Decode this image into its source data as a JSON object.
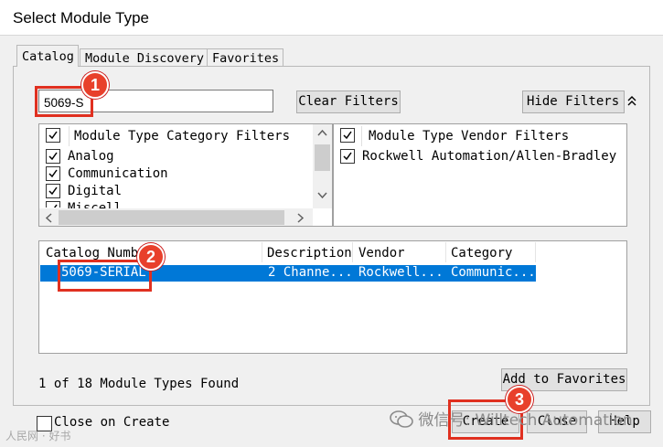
{
  "window": {
    "title": "Select Module Type"
  },
  "tabs": [
    {
      "label": "Catalog",
      "active": true
    },
    {
      "label": "Module Discovery",
      "active": false
    },
    {
      "label": "Favorites",
      "active": false
    }
  ],
  "search": {
    "value": "5069-S"
  },
  "buttons": {
    "clear_filters": "Clear Filters",
    "hide_filters": "Hide Filters",
    "hide_filters_icon": "double-chevron-up-icon",
    "add_to_favorites": "Add to Favorites",
    "create": "Create",
    "close": "Close",
    "help": "Help"
  },
  "category_filters": {
    "header": "Module Type Category Filters",
    "items": [
      {
        "label": "Analog",
        "checked": true
      },
      {
        "label": "Communication",
        "checked": true
      },
      {
        "label": "Digital",
        "checked": true
      },
      {
        "label": "Miscell",
        "checked": true
      }
    ]
  },
  "vendor_filters": {
    "header": "Module Type Vendor Filters",
    "items": [
      {
        "label": "Rockwell Automation/Allen-Bradley",
        "checked": true
      }
    ]
  },
  "results": {
    "columns": [
      "Catalog Numb",
      "Description",
      "Vendor",
      "Category"
    ],
    "rows": [
      {
        "catalog": "5069-SERIAL",
        "description": "2 Channe...",
        "vendor": "Rockwell...",
        "category": "Communic...",
        "selected": true
      }
    ]
  },
  "status": {
    "found_text": "1 of 18 Module Types Found"
  },
  "close_on_create": {
    "label": "Close on Create",
    "checked": false
  },
  "annotations": [
    "1",
    "2",
    "3"
  ],
  "watermarks": {
    "bottom_right": "微信号: Willtech Automation",
    "bottom_left": "人民网 · 好书"
  },
  "colors": {
    "selection": "#0078d7",
    "annotation_red": "#e03020"
  }
}
